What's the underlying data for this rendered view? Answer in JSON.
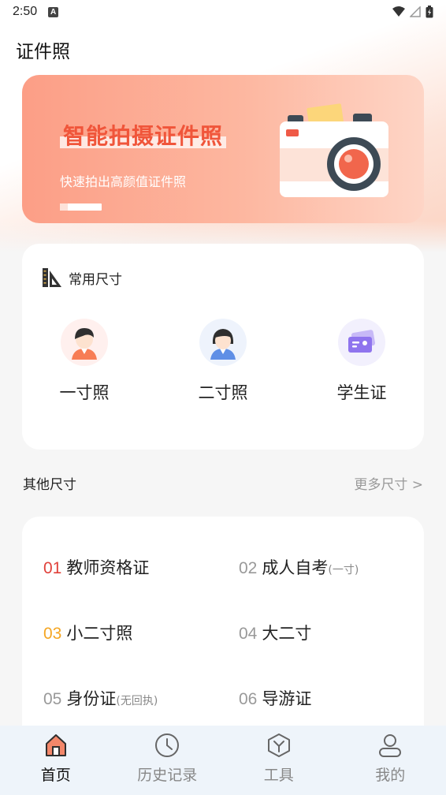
{
  "status_bar": {
    "time": "2:50",
    "notification_letter": "A"
  },
  "page": {
    "title": "证件照"
  },
  "banner": {
    "title": "智能拍摄证件照",
    "subtitle": "快速拍出高颜值证件照"
  },
  "common_sizes": {
    "title": "常用尺寸",
    "items": [
      {
        "label": "一寸照",
        "icon": "person-orange-icon"
      },
      {
        "label": "二寸照",
        "icon": "person-blue-icon"
      },
      {
        "label": "学生证",
        "icon": "id-card-icon"
      }
    ]
  },
  "other_sizes": {
    "title": "其他尺寸",
    "more": "更多尺寸 >",
    "items": [
      {
        "num": "01",
        "label": "教师资格证",
        "note": "",
        "num_color": "#e0413a"
      },
      {
        "num": "02",
        "label": "成人自考",
        "note": "(一寸)",
        "num_color": "#999999"
      },
      {
        "num": "03",
        "label": "小二寸照",
        "note": "",
        "num_color": "#f5a623"
      },
      {
        "num": "04",
        "label": "大二寸",
        "note": "",
        "num_color": "#999999"
      },
      {
        "num": "05",
        "label": "身份证",
        "note": "(无回执)",
        "num_color": "#999999"
      },
      {
        "num": "06",
        "label": "导游证",
        "note": "",
        "num_color": "#999999"
      }
    ]
  },
  "tabbar": {
    "tabs": [
      {
        "label": "首页",
        "icon": "home-icon",
        "active": true
      },
      {
        "label": "历史记录",
        "icon": "clock-icon",
        "active": false
      },
      {
        "label": "工具",
        "icon": "tools-icon",
        "active": false
      },
      {
        "label": "我的",
        "icon": "user-icon",
        "active": false
      }
    ]
  },
  "colors": {
    "accent": "#f0553a",
    "banner_start": "#fc9e86",
    "banner_end": "#fed5c6"
  }
}
